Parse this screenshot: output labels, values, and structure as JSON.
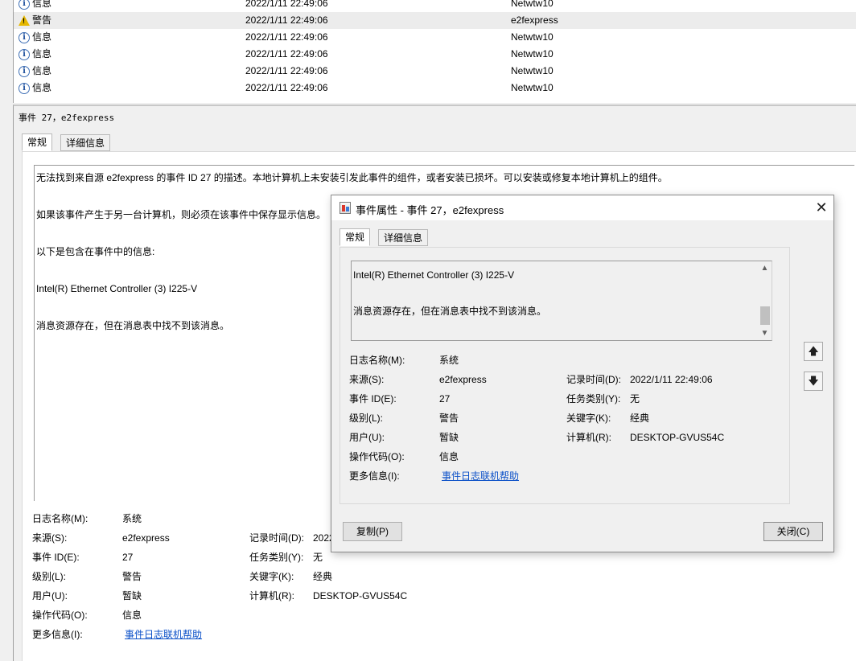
{
  "event_list": {
    "rows": [
      {
        "level": "信息",
        "icon": "info-icon",
        "date": "2022/1/11 22:49:06",
        "source": "Netwtw10"
      },
      {
        "level": "警告",
        "icon": "warning-icon",
        "date": "2022/1/11 22:49:06",
        "source": "e2fexpress"
      },
      {
        "level": "信息",
        "icon": "info-icon",
        "date": "2022/1/11 22:49:06",
        "source": "Netwtw10"
      },
      {
        "level": "信息",
        "icon": "info-icon",
        "date": "2022/1/11 22:49:06",
        "source": "Netwtw10"
      },
      {
        "level": "信息",
        "icon": "info-icon",
        "date": "2022/1/11 22:49:06",
        "source": "Netwtw10"
      },
      {
        "level": "信息",
        "icon": "info-icon",
        "date": "2022/1/11 22:49:06",
        "source": "Netwtw10"
      }
    ]
  },
  "details": {
    "title": "事件 27，e2fexpress",
    "tabs": [
      "常规",
      "详细信息"
    ],
    "description": [
      "无法找到来自源 e2fexpress 的事件 ID 27 的描述。本地计算机上未安装引发此事件的组件，或者安装已损坏。可以安装或修复本地计算机上的组件。",
      "如果该事件产生于另一台计算机，则必须在该事件中保存显示信息。",
      "以下是包含在事件中的信息:",
      "Intel(R) Ethernet Controller (3) I225-V",
      "消息资源存在，但在消息表中找不到该消息。"
    ],
    "props": {
      "log_name_label": "日志名称(M):",
      "log_name": "系统",
      "source_label": "来源(S):",
      "source": "e2fexpress",
      "logged_label": "记录时间(D):",
      "logged": "2022",
      "event_id_label": "事件 ID(E):",
      "event_id": "27",
      "task_label": "任务类别(Y):",
      "task": "无",
      "level_label": "级别(L):",
      "level": "警告",
      "keywords_label": "关键字(K):",
      "keywords": "经典",
      "user_label": "用户(U):",
      "user": "暂缺",
      "computer_label": "计算机(R):",
      "computer": "DESKTOP-GVUS54C",
      "opcode_label": "操作代码(O):",
      "opcode": "信息",
      "more_info_label": "更多信息(I):",
      "more_info": "事件日志联机帮助"
    }
  },
  "dialog": {
    "title": "事件属性 - 事件 27，e2fexpress",
    "close_glyph": "✕",
    "tabs": [
      "常规",
      "详细信息"
    ],
    "description": [
      "Intel(R) Ethernet Controller (3) I225-V",
      "消息资源存在，但在消息表中找不到该消息。"
    ],
    "props": {
      "log_name_label": "日志名称(M):",
      "log_name": "系统",
      "source_label": "来源(S):",
      "source": "e2fexpress",
      "logged_label": "记录时间(D):",
      "logged": "2022/1/11 22:49:06",
      "event_id_label": "事件 ID(E):",
      "event_id": "27",
      "task_label": "任务类别(Y):",
      "task": "无",
      "level_label": "级别(L):",
      "level": "警告",
      "keywords_label": "关键字(K):",
      "keywords": "经典",
      "user_label": "用户(U):",
      "user": "暂缺",
      "computer_label": "计算机(R):",
      "computer": "DESKTOP-GVUS54C",
      "opcode_label": "操作代码(O):",
      "opcode": "信息",
      "more_info_label": "更多信息(I):",
      "more_info": "事件日志联机帮助"
    },
    "copy_label": "复制(P)",
    "close_label": "关闭(C)"
  }
}
